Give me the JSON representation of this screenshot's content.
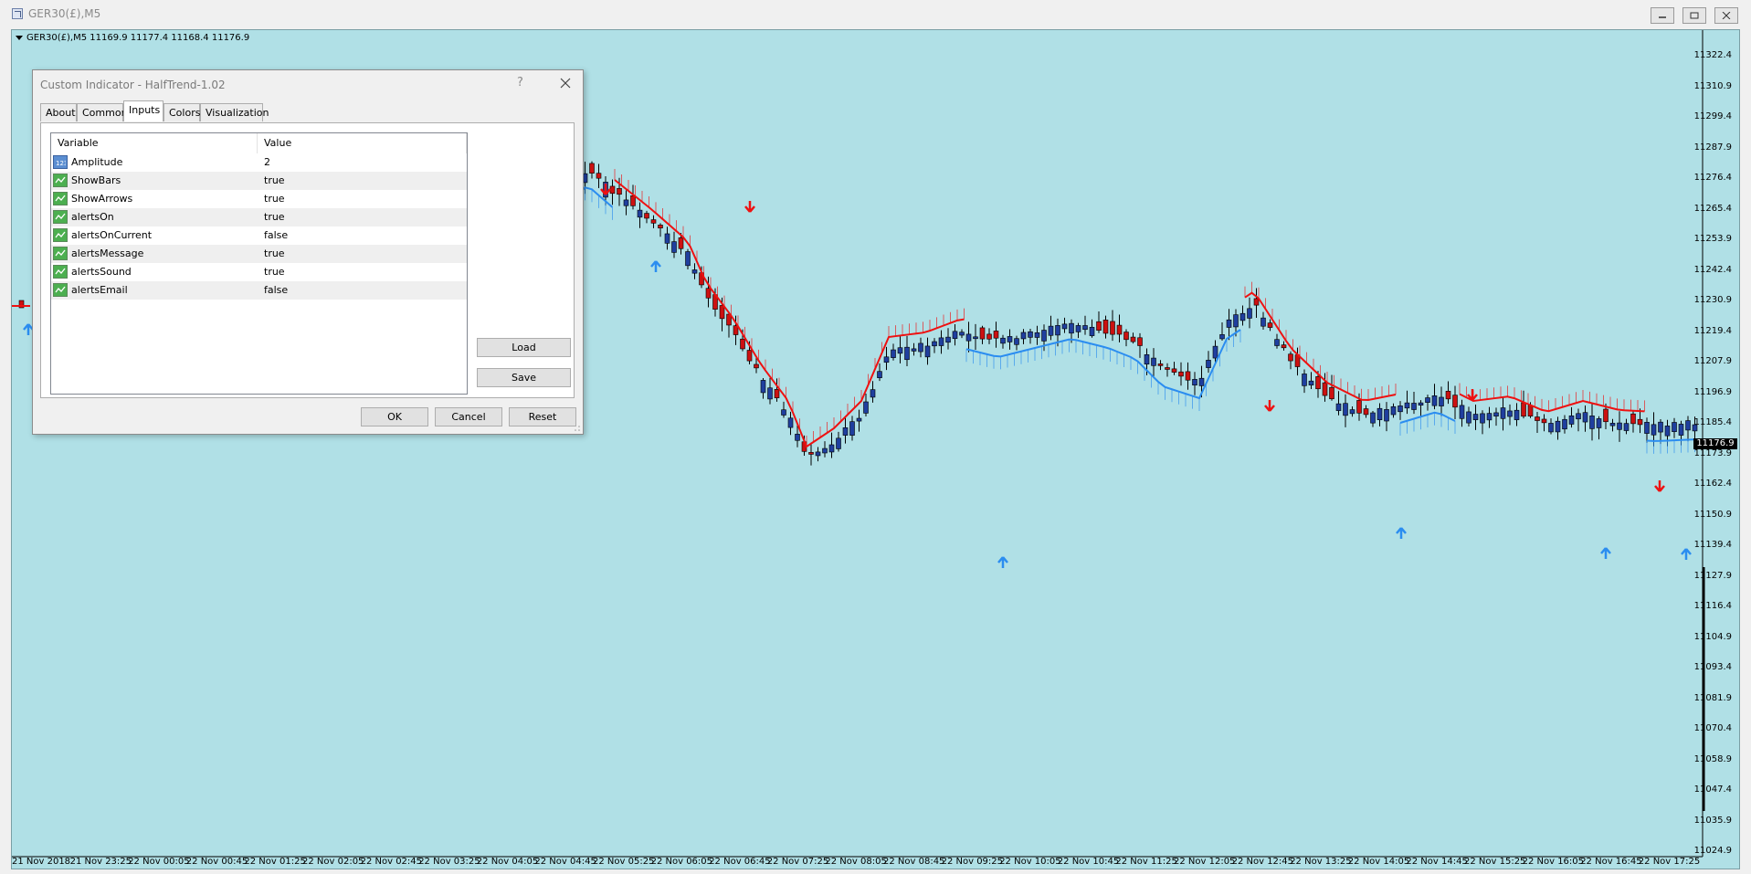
{
  "window": {
    "title": "GER30(£),M5"
  },
  "chart": {
    "symbol_line": "GER30(£),M5  11169.9 11177.4 11168.4 11176.9",
    "current_price": "11176.9",
    "colors": {
      "background": "#b0e0e6",
      "bull_candle": "#1f3f9f",
      "bear_candle": "#cc1111",
      "up_trend": "#2b8df0",
      "down_trend": "#ee1111"
    },
    "y_labels": [
      "11322.4",
      "11310.9",
      "11299.4",
      "11287.9",
      "11276.4",
      "11265.4",
      "11253.9",
      "11242.4",
      "11230.9",
      "11219.4",
      "11207.9",
      "11196.9",
      "11185.4",
      "11173.9",
      "11162.4",
      "11150.9",
      "11139.4",
      "11127.9",
      "11116.4",
      "11104.9",
      "11093.4",
      "11081.9",
      "11070.4",
      "11058.9",
      "11047.4",
      "11035.9",
      "11024.9"
    ],
    "x_labels": [
      "21 Nov 2018",
      "21 Nov 23:25",
      "22 Nov 00:05",
      "22 Nov 00:45",
      "22 Nov 01:25",
      "22 Nov 02:05",
      "22 Nov 02:45",
      "22 Nov 03:25",
      "22 Nov 04:05",
      "22 Nov 04:45",
      "22 Nov 05:25",
      "22 Nov 06:05",
      "22 Nov 06:45",
      "22 Nov 07:25",
      "22 Nov 08:05",
      "22 Nov 08:45",
      "22 Nov 09:25",
      "22 Nov 10:05",
      "22 Nov 10:45",
      "22 Nov 11:25",
      "22 Nov 12:05",
      "22 Nov 12:45",
      "22 Nov 13:25",
      "22 Nov 14:05",
      "22 Nov 14:45",
      "22 Nov 15:25",
      "22 Nov 16:05",
      "22 Nov 16:45",
      "22 Nov 17:25"
    ]
  },
  "dialog": {
    "title": "Custom Indicator - HalfTrend-1.02",
    "help": "?",
    "tabs": [
      "About",
      "Common",
      "Inputs",
      "Colors",
      "Visualization"
    ],
    "active_tab": "Inputs",
    "columns": [
      "Variable",
      "Value"
    ],
    "rows": [
      {
        "icon": "number-icon",
        "variable": "Amplitude",
        "value": "2"
      },
      {
        "icon": "bool-icon",
        "variable": "ShowBars",
        "value": "true"
      },
      {
        "icon": "bool-icon",
        "variable": "ShowArrows",
        "value": "true"
      },
      {
        "icon": "bool-icon",
        "variable": "alertsOn",
        "value": "true"
      },
      {
        "icon": "bool-icon",
        "variable": "alertsOnCurrent",
        "value": "false"
      },
      {
        "icon": "bool-icon",
        "variable": "alertsMessage",
        "value": "true"
      },
      {
        "icon": "bool-icon",
        "variable": "alertsSound",
        "value": "true"
      },
      {
        "icon": "bool-icon",
        "variable": "alertsEmail",
        "value": "false"
      }
    ],
    "buttons": {
      "load": "Load",
      "save": "Save",
      "ok": "OK",
      "cancel": "Cancel",
      "reset": "Reset"
    }
  }
}
